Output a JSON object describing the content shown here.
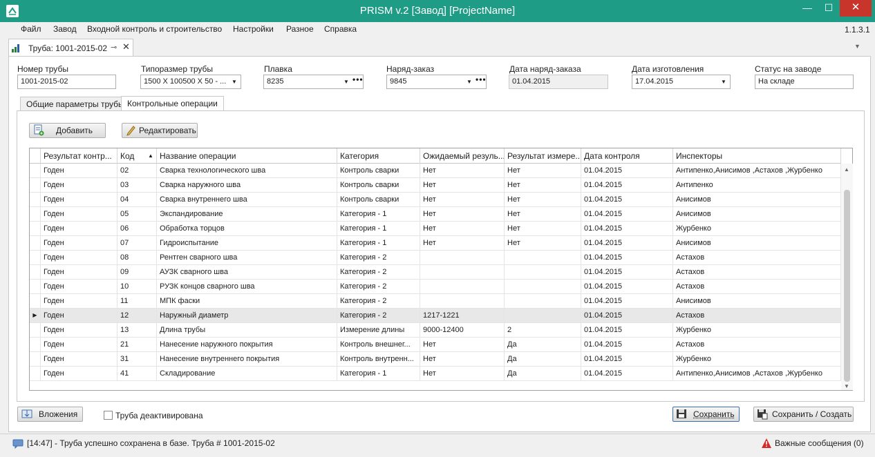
{
  "window": {
    "title": "PRISM v.2 [Завод] [ProjectName]",
    "app_icon": "app-logo-icon",
    "minimize": "—",
    "maximize": "☐",
    "close": "✕"
  },
  "menu": {
    "items": [
      "Файл",
      "Завод",
      "Входной контроль и строительство",
      "Настройки",
      "Разное",
      "Справка"
    ],
    "version": "1.1.3.1"
  },
  "doc_tab": {
    "label": "Труба: 1001-2015-02",
    "pin": "⊸",
    "close": "✕",
    "dropdown": "▼"
  },
  "fields": {
    "pipe_number": {
      "label": "Номер трубы",
      "value": "1001-2015-02"
    },
    "pipe_size": {
      "label": "Типоразмер трубы",
      "value": "1500 X 100500 X 50 - ..."
    },
    "heat": {
      "label": "Плавка",
      "value": "8235"
    },
    "work_order": {
      "label": "Наряд-заказ",
      "value": "9845"
    },
    "work_order_date": {
      "label": "Дата наряд-заказа",
      "value": "01.04.2015"
    },
    "manufacture_date": {
      "label": "Дата изготовления",
      "value": "17.04.2015"
    },
    "plant_status": {
      "label": "Статус на заводе",
      "value": "На складе"
    }
  },
  "glyphs": {
    "dropdown": "▼",
    "dots": "•••",
    "sort_up": "▲",
    "row_pointer": "▶",
    "scroll_up": "▲",
    "scroll_down": "▼"
  },
  "tabs": [
    {
      "label": "Общие параметры трубы"
    },
    {
      "label": "Контрольные операции"
    }
  ],
  "toolbar": {
    "add": "Добавить",
    "edit": "Редактировать"
  },
  "grid": {
    "columns": [
      "Результат контр...",
      "Код",
      "Название операции",
      "Категория",
      "Ожидаемый резуль...",
      "Результат измере...",
      "Дата контроля",
      "Инспекторы"
    ],
    "rows": [
      [
        "Годен",
        "02",
        "Сварка технологического шва",
        "Контроль сварки",
        "Нет",
        "Нет",
        "01.04.2015",
        "Антипенко,Анисимов ,Астахов ,Журбенко"
      ],
      [
        "Годен",
        "03",
        "Сварка наружного шва",
        "Контроль сварки",
        "Нет",
        "Нет",
        "01.04.2015",
        "Антипенко"
      ],
      [
        "Годен",
        "04",
        "Сварка внутреннего шва",
        "Контроль сварки",
        "Нет",
        "Нет",
        "01.04.2015",
        "Анисимов"
      ],
      [
        "Годен",
        "05",
        "Экспандирование",
        "Категория - 1",
        "Нет",
        "Нет",
        "01.04.2015",
        "Анисимов"
      ],
      [
        "Годен",
        "06",
        "Обработка торцов",
        "Категория - 1",
        "Нет",
        "Нет",
        "01.04.2015",
        "Журбенко"
      ],
      [
        "Годен",
        "07",
        "Гидроиспытание",
        "Категория - 1",
        "Нет",
        "Нет",
        "01.04.2015",
        "Анисимов"
      ],
      [
        "Годен",
        "08",
        "Рентген сварного шва",
        "Категория - 2",
        "",
        "",
        "01.04.2015",
        "Астахов"
      ],
      [
        "Годен",
        "09",
        "АУЗК сварного шва",
        "Категория - 2",
        "",
        "",
        "01.04.2015",
        "Астахов"
      ],
      [
        "Годен",
        "10",
        "РУЗК концов сварного шва",
        "Категория - 2",
        "",
        "",
        "01.04.2015",
        "Астахов"
      ],
      [
        "Годен",
        "11",
        "МПК фаски",
        "Категория - 2",
        "",
        "",
        "01.04.2015",
        "Анисимов"
      ],
      [
        "Годен",
        "12",
        "Наружный диаметр",
        "Категория - 2",
        "1217-1221",
        "",
        "01.04.2015",
        "Астахов"
      ],
      [
        "Годен",
        "13",
        "Длина трубы",
        "Измерение длины",
        "9000-12400",
        "2",
        "01.04.2015",
        "Журбенко"
      ],
      [
        "Годен",
        "21",
        "Нанесение наружного покрытия",
        "Контроль внешнег...",
        "Нет",
        "Да",
        "01.04.2015",
        "Астахов"
      ],
      [
        "Годен",
        "31",
        "Нанесение внутреннего покрытия",
        "Контроль внутренн...",
        "Нет",
        "Да",
        "01.04.2015",
        "Журбенко"
      ],
      [
        "Годен",
        "41",
        "Складирование",
        "Категория - 1",
        "Нет",
        "Да",
        "01.04.2015",
        "Антипенко,Анисимов ,Астахов ,Журбенко"
      ]
    ],
    "selected_row_index": 10
  },
  "bottom": {
    "attachments": "Вложения",
    "deactivated_label": "Труба деактивирована",
    "save": "Сохранить",
    "save_create": "Сохранить / Создать"
  },
  "status": {
    "message": "[14:47] - Труба успешно сохранена в базе. Труба  # 1001-2015-02",
    "important": "Важные сообщения (0)"
  },
  "colors": {
    "titlebar": "#1f9c86",
    "close": "#c7352b",
    "selected_row": "#e8e8e8"
  }
}
